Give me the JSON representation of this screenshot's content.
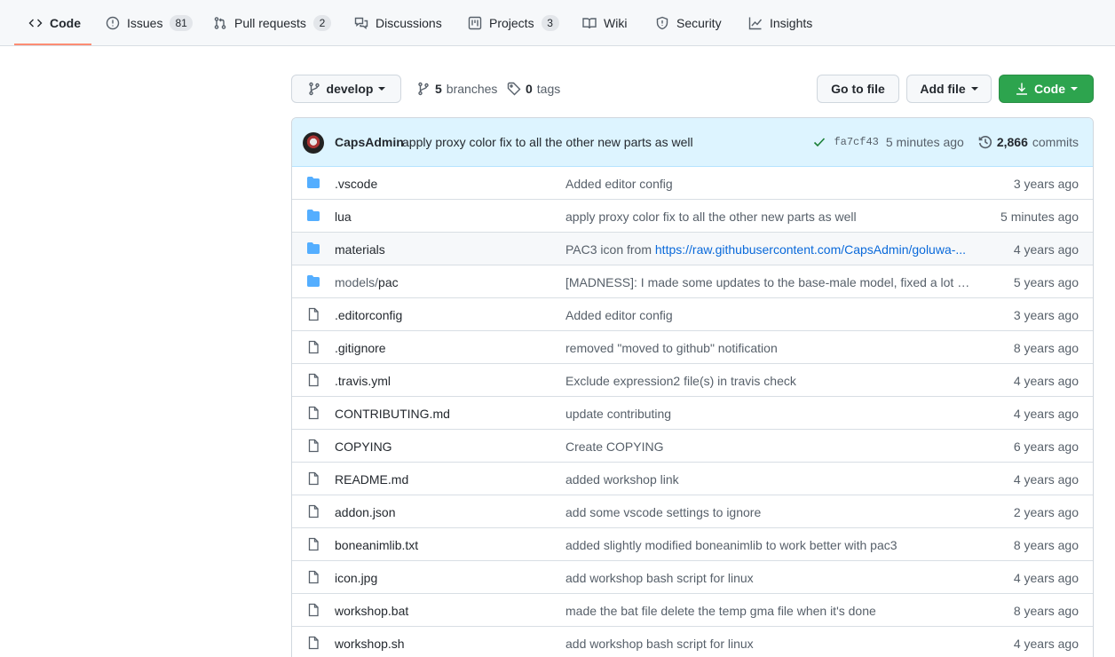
{
  "nav": {
    "tabs": [
      {
        "label": "Code",
        "icon": "code-icon",
        "active": true
      },
      {
        "label": "Issues",
        "count": "81",
        "icon": "issue-icon"
      },
      {
        "label": "Pull requests",
        "count": "2",
        "icon": "pull-request-icon"
      },
      {
        "label": "Discussions",
        "icon": "discussions-icon"
      },
      {
        "label": "Projects",
        "count": "3",
        "icon": "projects-icon"
      },
      {
        "label": "Wiki",
        "icon": "book-icon"
      },
      {
        "label": "Security",
        "icon": "shield-icon"
      },
      {
        "label": "Insights",
        "icon": "graph-icon"
      }
    ]
  },
  "toolbar": {
    "branch": "develop",
    "branches_count": "5",
    "branches_label": "branches",
    "tags_count": "0",
    "tags_label": "tags",
    "go_to_file": "Go to file",
    "add_file": "Add file",
    "code": "Code"
  },
  "latest_commit": {
    "author": "CapsAdmin",
    "message": "apply proxy color fix to all the other new parts as well",
    "sha": "fa7cf43",
    "time": "5 minutes ago",
    "commits_count": "2,866",
    "commits_label": "commits"
  },
  "files": [
    {
      "type": "dir",
      "name": ".vscode",
      "message": "Added editor config",
      "age": "3 years ago"
    },
    {
      "type": "dir",
      "name": "lua",
      "message": "apply proxy color fix to all the other new parts as well",
      "age": "5 minutes ago"
    },
    {
      "type": "dir",
      "name": "materials",
      "message": "PAC3 icon from ",
      "link": "https://raw.githubusercontent.com/CapsAdmin/goluwa-...",
      "age": "4 years ago"
    },
    {
      "type": "dir",
      "name_dim": "models/",
      "name": "pac",
      "message": "[MADNESS]: I made some updates to the base-male model, fixed a lot of...",
      "age": "5 years ago"
    },
    {
      "type": "file",
      "name": ".editorconfig",
      "message": "Added editor config",
      "age": "3 years ago"
    },
    {
      "type": "file",
      "name": ".gitignore",
      "message": "removed \"moved to github\" notification",
      "age": "8 years ago"
    },
    {
      "type": "file",
      "name": ".travis.yml",
      "message": "Exclude expression2 file(s) in travis check",
      "age": "4 years ago"
    },
    {
      "type": "file",
      "name": "CONTRIBUTING.md",
      "message": "update contributing",
      "age": "4 years ago"
    },
    {
      "type": "file",
      "name": "COPYING",
      "message": "Create COPYING",
      "age": "6 years ago"
    },
    {
      "type": "file",
      "name": "README.md",
      "message": "added workshop link",
      "age": "4 years ago"
    },
    {
      "type": "file",
      "name": "addon.json",
      "message": "add some vscode settings to ignore",
      "age": "2 years ago"
    },
    {
      "type": "file",
      "name": "boneanimlib.txt",
      "message": "added slightly modified boneanimlib to work better with pac3",
      "age": "8 years ago"
    },
    {
      "type": "file",
      "name": "icon.jpg",
      "message": "add workshop bash script for linux",
      "age": "4 years ago"
    },
    {
      "type": "file",
      "name": "workshop.bat",
      "message": "made the bat file delete the temp gma file when it's done",
      "age": "8 years ago"
    },
    {
      "type": "file",
      "name": "workshop.sh",
      "message": "add workshop bash script for linux",
      "age": "4 years ago"
    }
  ]
}
